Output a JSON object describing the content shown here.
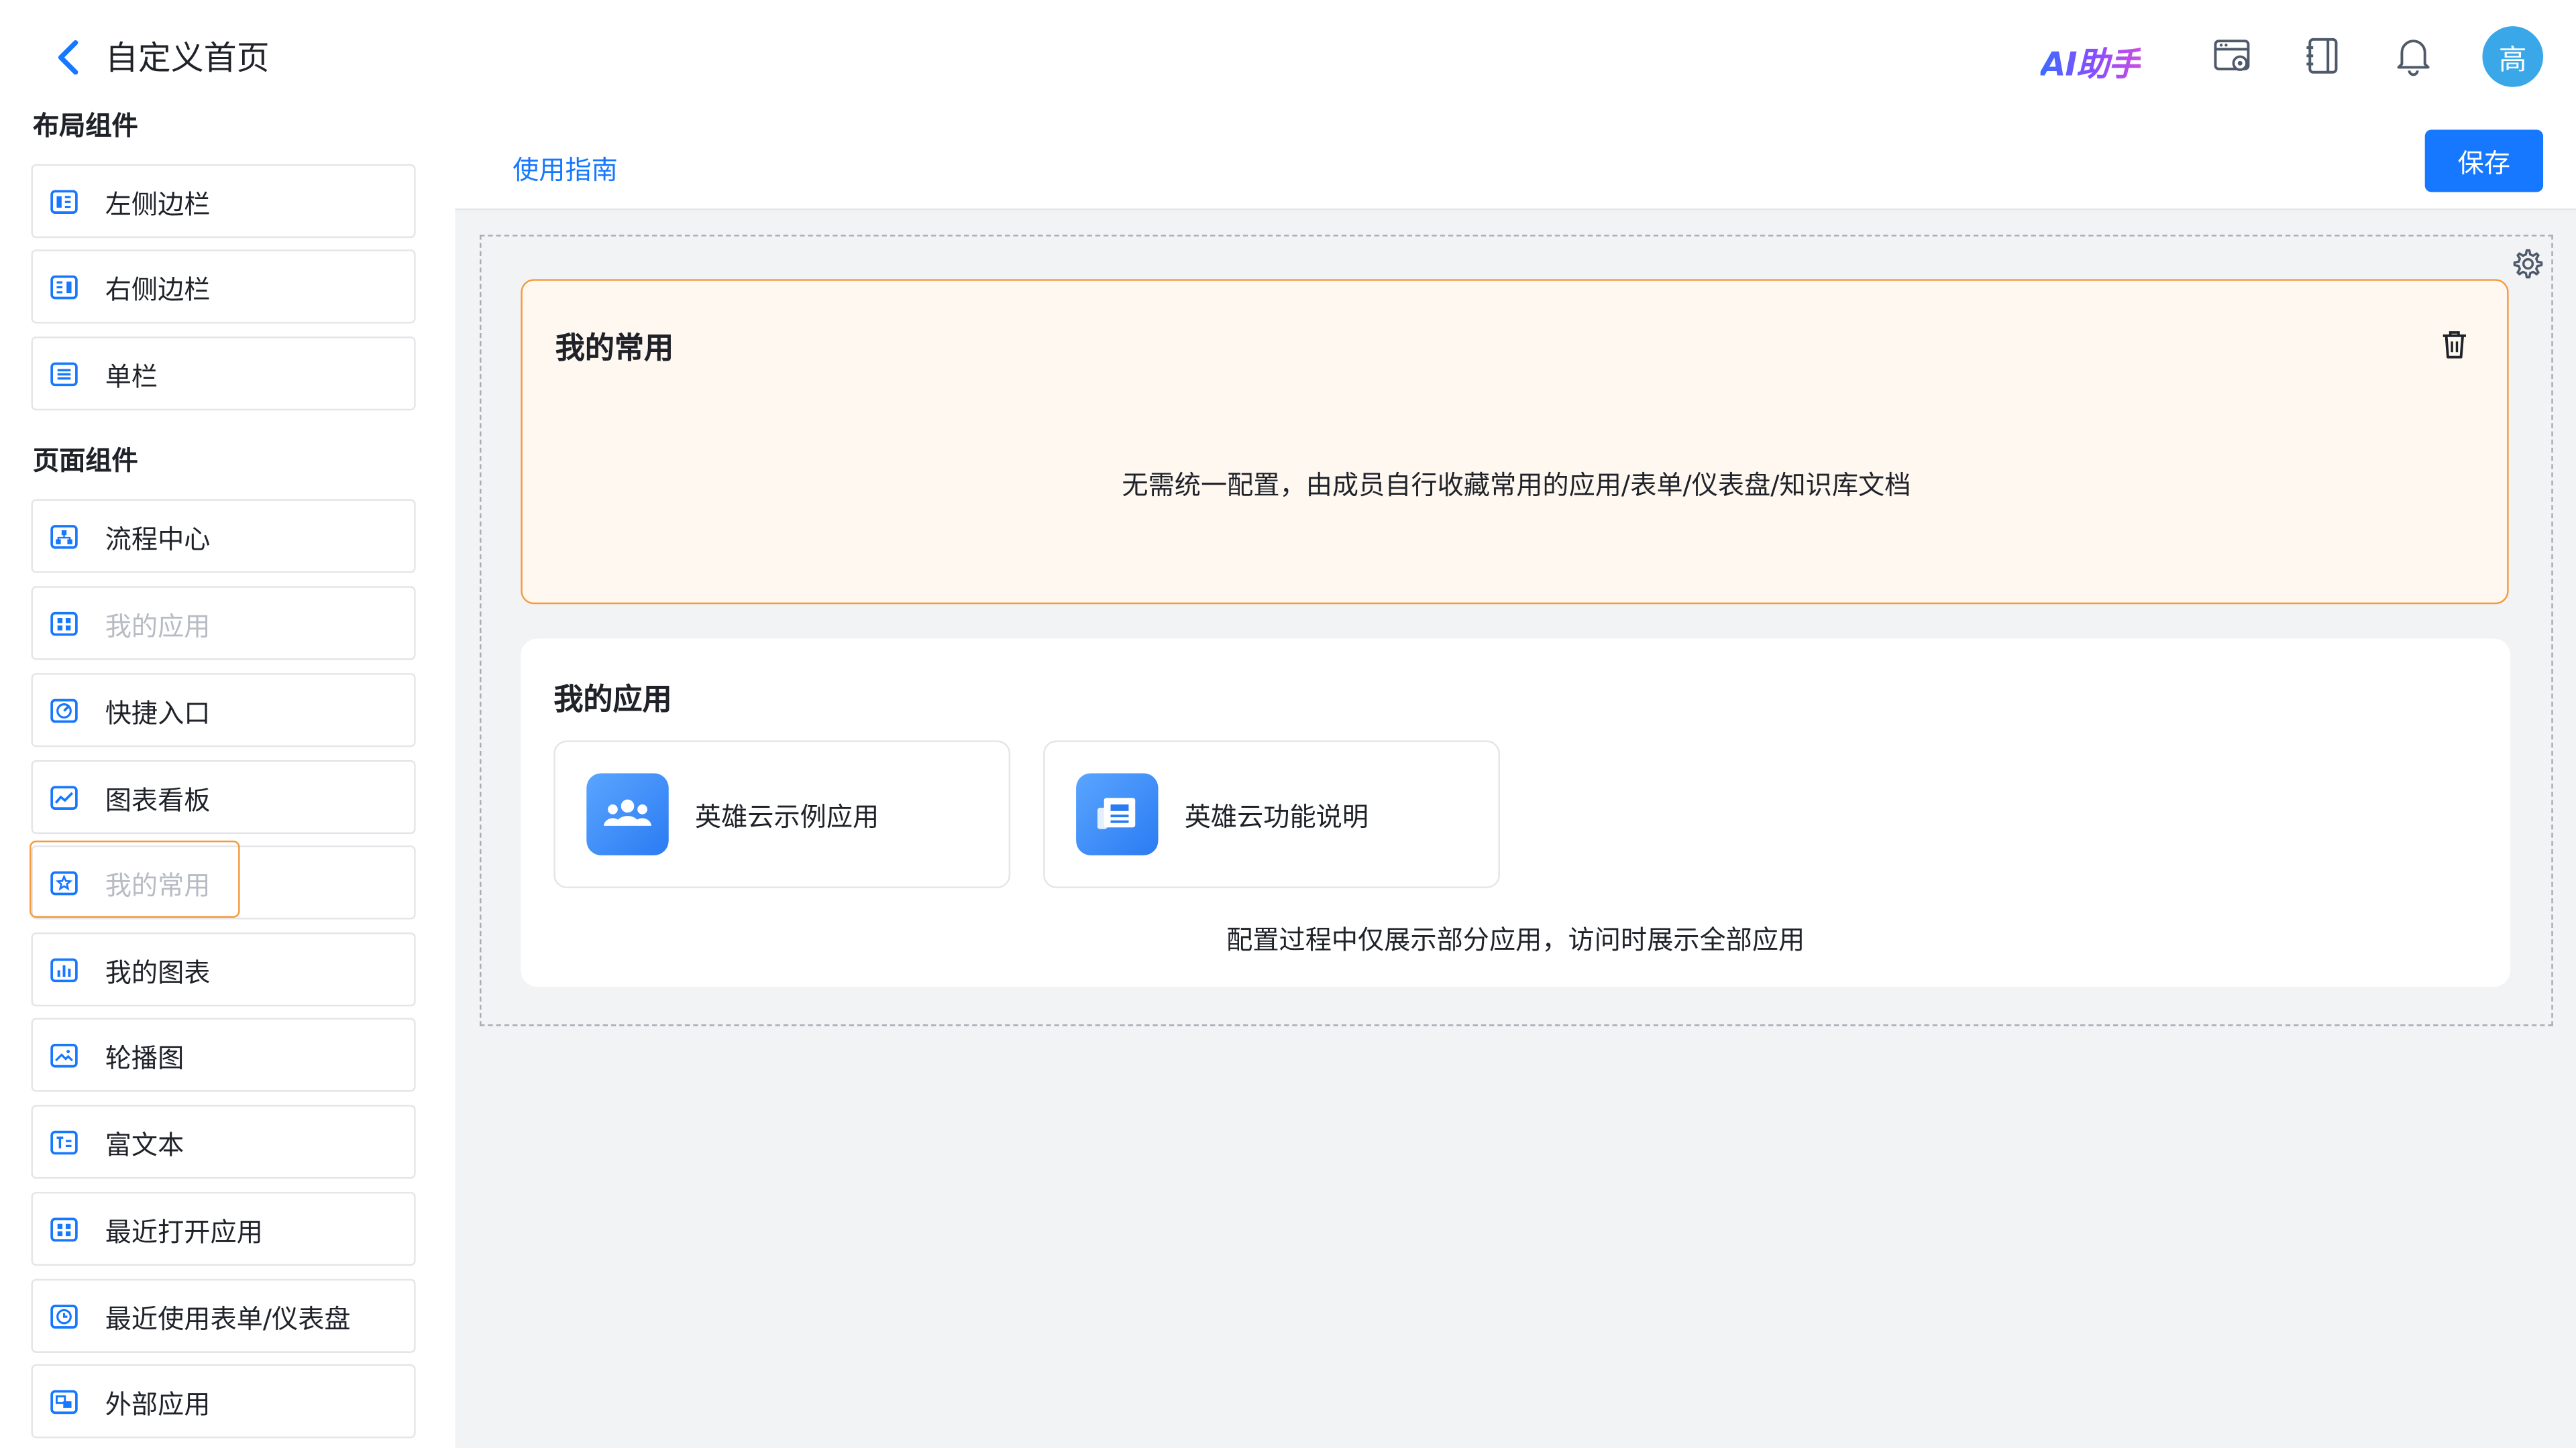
{
  "header": {
    "title": "自定义首页",
    "ai_assistant": "AI助手",
    "avatar_text": "高"
  },
  "sidebar": {
    "layout_section_title": "布局组件",
    "layout_items": [
      {
        "label": "左侧边栏",
        "icon": "left-sidebar-icon"
      },
      {
        "label": "右侧边栏",
        "icon": "right-sidebar-icon"
      },
      {
        "label": "单栏",
        "icon": "single-column-icon"
      }
    ],
    "page_section_title": "页面组件",
    "page_items": [
      {
        "label": "流程中心",
        "icon": "workflow-icon",
        "disabled": false
      },
      {
        "label": "我的应用",
        "icon": "apps-grid-icon",
        "disabled": true
      },
      {
        "label": "快捷入口",
        "icon": "shortcut-icon",
        "disabled": false
      },
      {
        "label": "图表看板",
        "icon": "line-chart-icon",
        "disabled": false
      },
      {
        "label": "我的常用",
        "icon": "star-icon",
        "disabled": true
      },
      {
        "label": "我的图表",
        "icon": "bar-chart-icon",
        "disabled": false
      },
      {
        "label": "轮播图",
        "icon": "carousel-icon",
        "disabled": false
      },
      {
        "label": "富文本",
        "icon": "rich-text-icon",
        "disabled": false
      },
      {
        "label": "最近打开应用",
        "icon": "recent-apps-icon",
        "disabled": false
      },
      {
        "label": "最近使用表单/仪表盘",
        "icon": "clock-icon",
        "disabled": false
      },
      {
        "label": "外部应用",
        "icon": "external-app-icon",
        "disabled": false
      }
    ]
  },
  "main": {
    "guide_link": "使用指南",
    "save_label": "保存",
    "favorites_card": {
      "title": "我的常用",
      "description": "无需统一配置，由成员自行收藏常用的应用/表单/仪表盘/知识库文档"
    },
    "apps_card": {
      "title": "我的应用",
      "apps": [
        {
          "name": "英雄云示例应用",
          "icon": "team-icon"
        },
        {
          "name": "英雄云功能说明",
          "icon": "document-icon"
        }
      ],
      "note": "配置过程中仅展示部分应用，访问时展示全部应用"
    }
  },
  "colors": {
    "accent": "#1677ff",
    "highlight_border": "#f59a3d",
    "highlight_bg": "#fff8f1",
    "avatar_bg": "#3aa8e8"
  }
}
